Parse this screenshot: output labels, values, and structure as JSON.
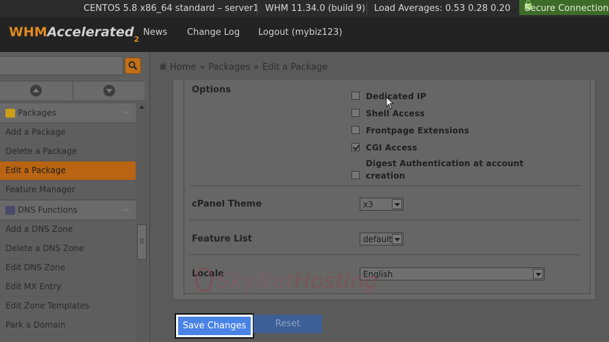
{
  "statusbar": {
    "server": "CENTOS 5.8 x86_64 standard – server1",
    "version": "WHM 11.34.0 (build 9)",
    "load": "Load Averages: 0.53 0.28 0.20",
    "secure": "Secure Connection"
  },
  "header": {
    "logo_whm": "WHM",
    "logo_accelerated": "Accelerated",
    "logo_two": "2",
    "nav": [
      "News",
      "Change Log",
      "Logout (mybiz123)"
    ]
  },
  "sidebar": {
    "search_placeholder": "",
    "categories": [
      {
        "label": "Packages",
        "icon": "package-icon",
        "items": [
          "Add a Package",
          "Delete a Package",
          "Edit a Package",
          "Feature Manager"
        ],
        "active": "Edit a Package"
      },
      {
        "label": "DNS Functions",
        "icon": "dns-icon",
        "items": [
          "Add a DNS Zone",
          "Delete a DNS Zone",
          "Edit DNS Zone",
          "Edit MX Entry",
          "Edit Zone Templates",
          "Park a Domain"
        ]
      }
    ]
  },
  "breadcrumb": {
    "home": "Home",
    "sep": "»",
    "packages": "Packages",
    "current": "Edit a Package"
  },
  "form": {
    "options_label": "Options",
    "options": [
      {
        "label": "Dedicated IP",
        "checked": false
      },
      {
        "label": "Shell Access",
        "checked": false
      },
      {
        "label": "Frontpage Extensions",
        "checked": false
      },
      {
        "label": "CGI Access",
        "checked": true
      },
      {
        "label": "Digest Authentication at account",
        "label2": "creation",
        "checked": false
      }
    ],
    "theme_label": "cPanel Theme",
    "theme_value": "x3",
    "feature_label": "Feature List",
    "feature_value": "default",
    "locale_label": "Locale",
    "locale_value": "English"
  },
  "watermark": {
    "sky": "SkyNet",
    "hosting": "Hosting"
  },
  "buttons": {
    "save": "Save Changes",
    "reset": "Reset"
  },
  "colors": {
    "accent_orange": "#b86412",
    "save_blue": "#4a83e6",
    "secure_green": "#3f6b2a"
  }
}
